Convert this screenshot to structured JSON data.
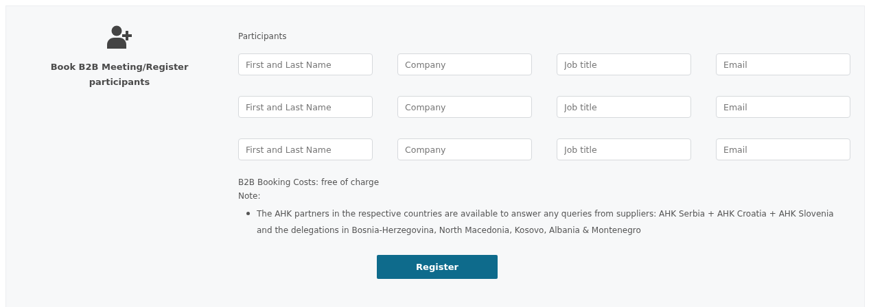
{
  "sidebar": {
    "title": "Book B2B Meeting/Register participants"
  },
  "form": {
    "label": "Participants",
    "rows": [
      {
        "fields": [
          {
            "placeholder": "First and Last Name"
          },
          {
            "placeholder": "Company"
          },
          {
            "placeholder": "Job title"
          },
          {
            "placeholder": "Email"
          }
        ]
      },
      {
        "fields": [
          {
            "placeholder": "First and Last Name"
          },
          {
            "placeholder": "Company"
          },
          {
            "placeholder": "Job title"
          },
          {
            "placeholder": "Email"
          }
        ]
      },
      {
        "fields": [
          {
            "placeholder": "First and Last Name"
          },
          {
            "placeholder": "Company"
          },
          {
            "placeholder": "Job title"
          },
          {
            "placeholder": "Email"
          }
        ]
      }
    ],
    "costs": "B2B Booking Costs: free of charge",
    "note_label": "Note:",
    "notes": [
      "The AHK partners in the respective countries are available to answer any queries from suppliers: AHK Serbia + AHK Croatia + AHK Slovenia and the delegations in Bosnia-Herzegovina, North Macedonia, Kosovo, Albania & Montenegro"
    ],
    "button": "Register"
  }
}
